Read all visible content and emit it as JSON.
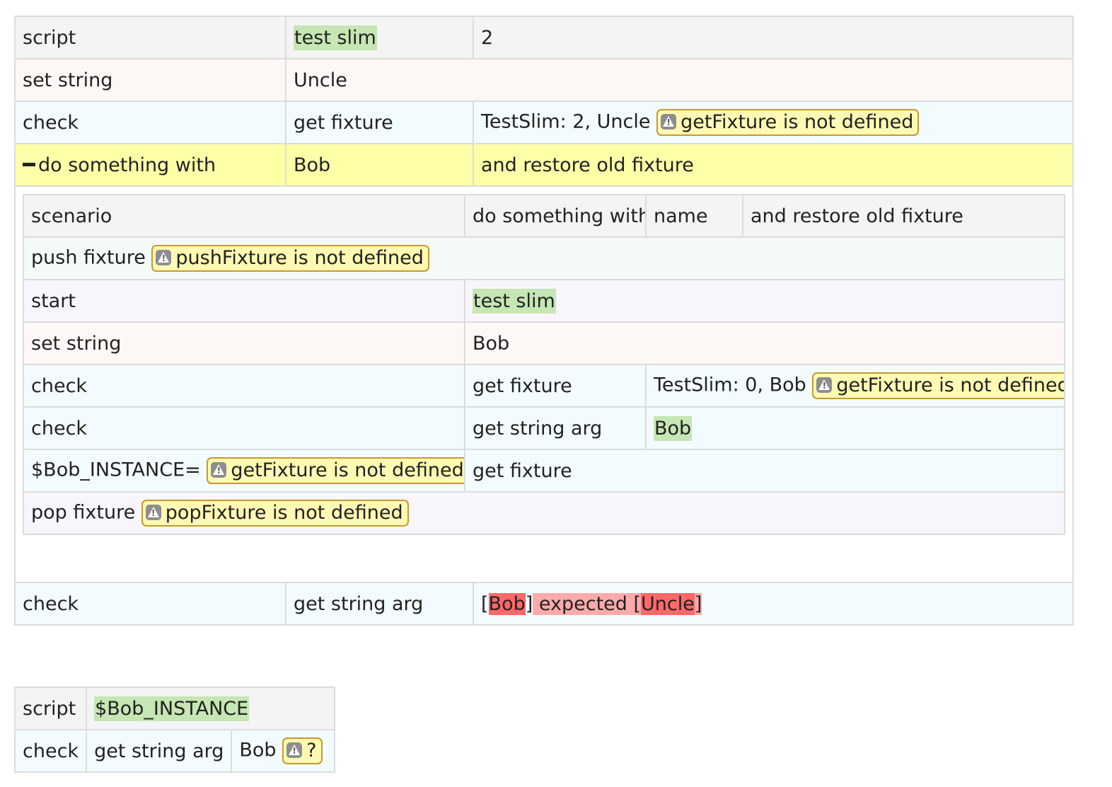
{
  "main_table": {
    "row1": {
      "c1": "script",
      "c2": "test slim",
      "c3": "2"
    },
    "row2": {
      "c1": "set string",
      "c2": "Uncle"
    },
    "row3": {
      "c1": "check",
      "c2": "get fixture",
      "c3": "TestSlim: 2, Uncle",
      "error": "getFixture is not defined"
    },
    "row4": {
      "c1": "do something with",
      "c2": "Bob",
      "c3": "and restore old fixture"
    },
    "scenario": {
      "header": {
        "c1": "scenario",
        "c2": "do something with",
        "c3": "name",
        "c4": "and restore old fixture"
      },
      "push": {
        "label": "push fixture",
        "error": "pushFixture is not defined"
      },
      "start": {
        "c1": "start",
        "c2": "test slim"
      },
      "set_string": {
        "c1": "set string",
        "c2": "Bob"
      },
      "check_fixture": {
        "c1": "check",
        "c2": "get fixture",
        "c3": "TestSlim: 0, Bob",
        "error": "getFixture is not defined"
      },
      "check_string": {
        "c1": "check",
        "c2": "get string arg",
        "c3": "Bob"
      },
      "assign": {
        "label": "$Bob_INSTANCE=",
        "error": "getFixture is not defined",
        "c2": "get fixture"
      },
      "pop": {
        "label": "pop fixture",
        "error": "popFixture is not defined"
      }
    },
    "row_last": {
      "c1": "check",
      "c2": "get string arg",
      "open1": "[",
      "actual": "Bob",
      "close1": "]",
      "expected_label": " expected [",
      "expected": "Uncle",
      "close2": "]"
    }
  },
  "second_table": {
    "row1": {
      "c1": "script",
      "c2": "$Bob_INSTANCE"
    },
    "row2": {
      "c1": "check",
      "c2": "get string arg",
      "c3": "Bob",
      "error": "?"
    }
  },
  "colors": {
    "pass": "#c6e6b4",
    "fail": "#ff6868",
    "error_bg": "#fff9b3",
    "highlight_row": "#ffffa8"
  }
}
